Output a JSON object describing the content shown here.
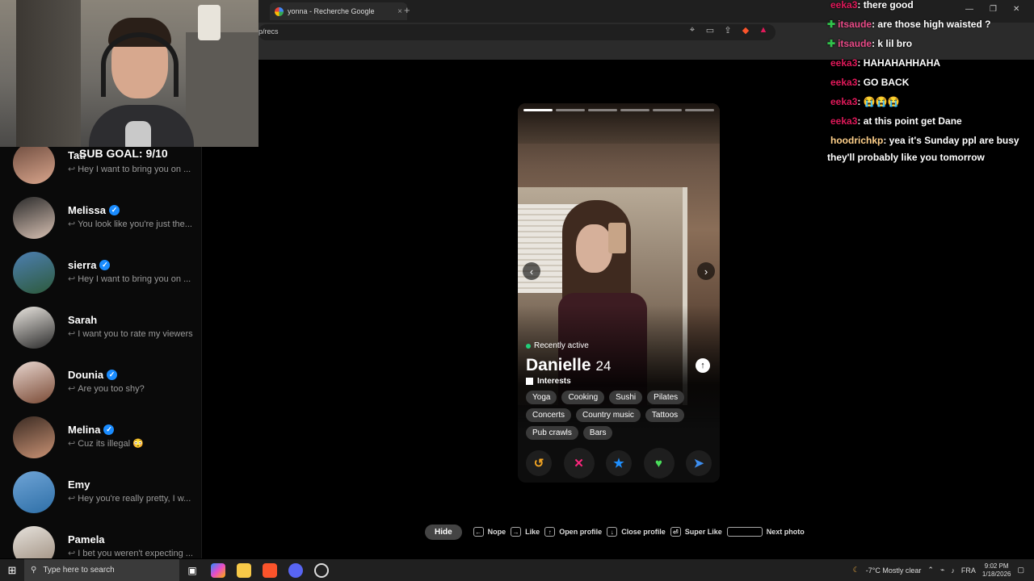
{
  "browser": {
    "tab_title": "yonna - Recherche Google",
    "new_tab": "+",
    "tab_close": "×",
    "address": "p/recs"
  },
  "overlay": {
    "sub_goal": "SUB GOAL: 9/10"
  },
  "sidebar": {
    "matches": [
      {
        "name": "Tati",
        "verified": false,
        "message": "Hey I want to bring you on ...",
        "avatar_colors": [
          "#6b4a3d",
          "#d9a58c"
        ]
      },
      {
        "name": "Melissa",
        "verified": true,
        "message": "You look like you're just the...",
        "avatar_colors": [
          "#2a2a2a",
          "#d8c1b3"
        ]
      },
      {
        "name": "sierra",
        "verified": true,
        "message": "Hey I want to bring you on ...",
        "avatar_colors": [
          "#4d7fb2",
          "#2d5a3b"
        ]
      },
      {
        "name": "Sarah",
        "verified": false,
        "message": "I want you to rate my viewers",
        "avatar_colors": [
          "#eae6e0",
          "#2b2b2b"
        ]
      },
      {
        "name": "Dounia",
        "verified": true,
        "message": "Are you too shy?",
        "avatar_colors": [
          "#e8d6cf",
          "#7a4a35"
        ]
      },
      {
        "name": "Melina",
        "verified": true,
        "message": "Cuz its illegal 😳",
        "avatar_colors": [
          "#3a2a22",
          "#c99274"
        ]
      },
      {
        "name": "Emy",
        "verified": false,
        "message": "Hey you're really pretty, I w...",
        "avatar_colors": [
          "#6fa4d6",
          "#2e6fa7"
        ]
      },
      {
        "name": "Pamela",
        "verified": false,
        "message": "I bet you weren't expecting ...",
        "avatar_colors": [
          "#e6e2dc",
          "#9b8a7a"
        ]
      }
    ]
  },
  "profile": {
    "photo_count": 6,
    "current_photo": 1,
    "status": "Recently active",
    "name": "Danielle",
    "age": "24",
    "interests_label": "Interests",
    "interests": [
      "Yoga",
      "Cooking",
      "Sushi",
      "Pilates",
      "Concerts",
      "Country music",
      "Tattoos",
      "Pub crawls",
      "Bars"
    ],
    "prev_arrow": "‹",
    "next_arrow": "›",
    "info_icon": "↑"
  },
  "actions": {
    "rewind": "↺",
    "nope": "✕",
    "super_like": "★",
    "like": "♥",
    "boost": "➤",
    "colors": {
      "rewind": "#f5a623",
      "nope": "#fd267d",
      "super_like": "#1e8fff",
      "like": "#4ade5b",
      "boost": "#3d8ef0"
    }
  },
  "shortcuts": {
    "hide": "Hide",
    "items": [
      {
        "key": "←",
        "label": "Nope"
      },
      {
        "key": "→",
        "label": "Like"
      },
      {
        "key": "↑",
        "label": "Open profile"
      },
      {
        "key": "↓",
        "label": "Close profile"
      },
      {
        "key": "⏎",
        "label": "Super Like"
      },
      {
        "key": "",
        "label": "Next photo"
      }
    ]
  },
  "chat": {
    "messages": [
      {
        "user": "eeka3",
        "text": ": there good",
        "badge": false,
        "color": "#e0195a"
      },
      {
        "user": "itsaude",
        "text": ": are those high waisted ?",
        "badge": true,
        "color": "#e84a87"
      },
      {
        "user": "itsaude",
        "text": ": k lil bro",
        "badge": true,
        "color": "#e84a87"
      },
      {
        "user": "eeka3",
        "text": ": HAHAHAHHAHA",
        "badge": false,
        "color": "#e0195a"
      },
      {
        "user": "eeka3",
        "text": ": GO BACK",
        "badge": false,
        "color": "#e0195a"
      },
      {
        "user": "eeka3",
        "text": ": 😭😭😭",
        "badge": false,
        "color": "#e0195a"
      },
      {
        "user": "eeka3",
        "text": ": at this point get Dane",
        "badge": false,
        "color": "#e0195a"
      },
      {
        "user": "hoodrichkp",
        "text": ": yea it's Sunday ppl are busy they'll probably like you tomorrow",
        "badge": false,
        "color": "#ffd08a"
      }
    ]
  },
  "taskbar": {
    "search_placeholder": "Type here to search",
    "weather": "-7°C  Mostly clear",
    "lang": "FRA",
    "time": "9:02 PM",
    "date": "1/18/2026"
  }
}
